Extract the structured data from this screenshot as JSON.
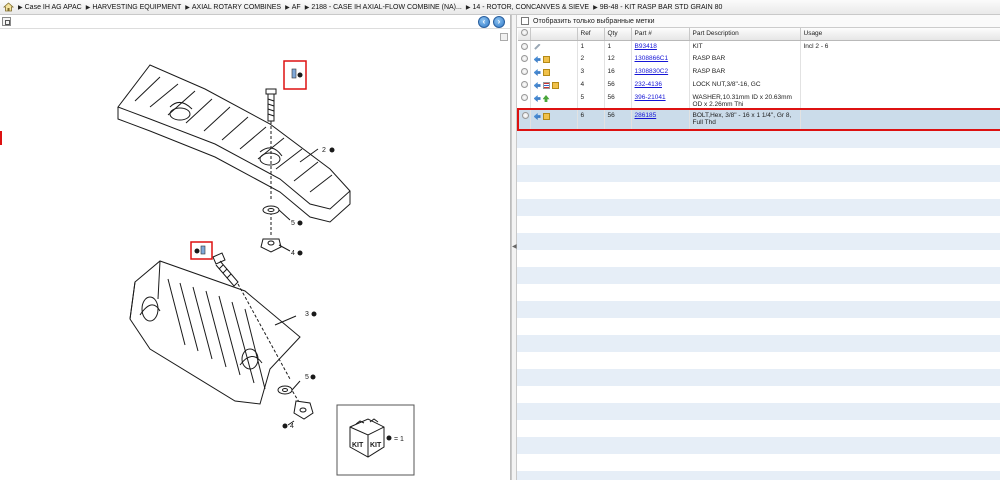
{
  "breadcrumbs": [
    "Case IH AG APAC",
    "HARVESTING EQUIPMENT",
    "AXIAL ROTARY COMBINES",
    "AF",
    "2188 - CASE IH AXIAL-FLOW COMBINE (NA)...",
    "14 - ROTOR, CONCANVES & SIEVE",
    "9B-48 - KIT RASP BAR STD GRAIN 80"
  ],
  "filter": {
    "label": "Отобразить только выбранные метки"
  },
  "table": {
    "columns": [
      "Ref",
      "Qty",
      "Part #",
      "Part Description",
      "Usage"
    ],
    "rows": [
      {
        "ref": "1",
        "qty": "1",
        "part": "B93418",
        "desc": "KIT",
        "usage": "Incl 2 - 6"
      },
      {
        "ref": "2",
        "qty": "12",
        "part": "1308866C1",
        "desc": "RASP BAR",
        "usage": ""
      },
      {
        "ref": "3",
        "qty": "16",
        "part": "1308830C2",
        "desc": "RASP BAR",
        "usage": ""
      },
      {
        "ref": "4",
        "qty": "56",
        "part": "232-4136",
        "desc": "LOCK NUT,3/8\"-16, GC",
        "usage": ""
      },
      {
        "ref": "5",
        "qty": "56",
        "part": "396-21041",
        "desc": "WASHER,10.31mm ID x 20.63mm OD x 2.26mm Thi",
        "usage": ""
      },
      {
        "ref": "6",
        "qty": "56",
        "part": "286185",
        "desc": "BOLT,Hex, 3/8\" - 16 x 1 1/4\", Gr 8, Full Thd",
        "usage": ""
      }
    ]
  },
  "drawing": {
    "callouts": [
      "2",
      "3",
      "4",
      "5",
      "5",
      "4"
    ],
    "legend": "= 1",
    "kit_text": "KIT"
  },
  "colors": {
    "accent": "#2f79c8",
    "selection": "#cbdcea",
    "highlight": "#dd1111",
    "link": "#1515d6"
  }
}
